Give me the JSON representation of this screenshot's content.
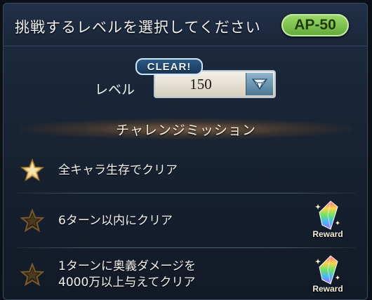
{
  "header": {
    "title": "挑戦するレベルを選択してください",
    "ap_cost": "AP-50"
  },
  "level": {
    "clear_badge": "CLEAR!",
    "label": "レベル",
    "selected_value": "150"
  },
  "missions": {
    "heading": "チャレンジミッション",
    "items": [
      {
        "text": "全キャラ生存でクリア",
        "achieved": true,
        "reward": null
      },
      {
        "text": "6ターン以内にクリア",
        "achieved": false,
        "reward": "Reward"
      },
      {
        "line1": "1ターンに奥義ダメージを",
        "line2": "4000万以上与えてクリア",
        "achieved": false,
        "reward": "Reward"
      }
    ]
  },
  "colors": {
    "ap_badge": "#7cc24f",
    "star_achieved": "#e6c77a",
    "star_unachieved": "#6b5128"
  }
}
